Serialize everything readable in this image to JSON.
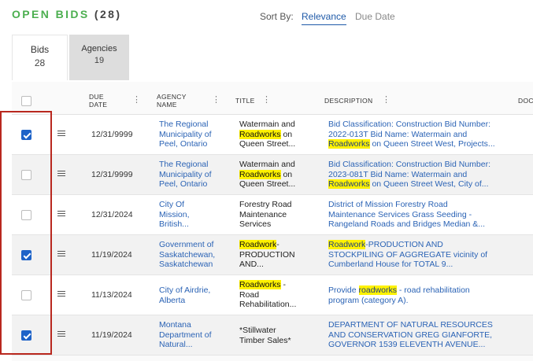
{
  "header": {
    "title_word": "OPEN BIDS",
    "title_count": "(28)",
    "sort_label": "Sort By:",
    "sort_options": [
      "Relevance",
      "Due Date"
    ],
    "sort_selected": "Relevance"
  },
  "tabs": [
    {
      "label": "Bids",
      "count": "28",
      "active": true
    },
    {
      "label": "Agencies",
      "count": "19",
      "active": false
    }
  ],
  "columns": {
    "due_date": [
      "DUE",
      "DATE"
    ],
    "agency": [
      "AGENCY",
      "NAME"
    ],
    "title": "TITLE",
    "description": "DESCRIPTION",
    "doc": "DOC"
  },
  "rows": [
    {
      "checked": true,
      "due_date": "12/31/9999",
      "agency": [
        "The Regional",
        "Municipality of",
        "Peel, Ontario"
      ],
      "title": [
        [
          "Watermain and"
        ],
        [
          {
            "hl": "Roadworks"
          },
          " on"
        ],
        [
          "Queen Street..."
        ]
      ],
      "description": [
        [
          "Bid Classification: Construction Bid Number:"
        ],
        [
          "2022-013T Bid Name: Watermain and"
        ],
        [
          {
            "hl": "Roadworks"
          },
          " on Queen Street West, Projects..."
        ]
      ]
    },
    {
      "checked": false,
      "due_date": "12/31/9999",
      "agency": [
        "The Regional",
        "Municipality of",
        "Peel, Ontario"
      ],
      "title": [
        [
          "Watermain and"
        ],
        [
          {
            "hl": "Roadworks"
          },
          " on"
        ],
        [
          "Queen Street..."
        ]
      ],
      "description": [
        [
          "Bid Classification: Construction Bid Number:"
        ],
        [
          "2023-081T Bid Name: Watermain and"
        ],
        [
          {
            "hl": "Roadworks"
          },
          " on Queen Street West, City of..."
        ]
      ]
    },
    {
      "checked": false,
      "due_date": "12/31/2024",
      "agency": [
        "City Of",
        "Mission,",
        "British..."
      ],
      "title": [
        [
          "Forestry Road"
        ],
        [
          "Maintenance"
        ],
        [
          "Services"
        ]
      ],
      "description": [
        [
          "District of Mission Forestry Road"
        ],
        [
          "Maintenance Services Grass Seeding -"
        ],
        [
          "Rangeland Roads and Bridges Median &..."
        ]
      ]
    },
    {
      "checked": true,
      "due_date": "11/19/2024",
      "agency": [
        "Government of",
        "Saskatchewan,",
        "Saskatchewan"
      ],
      "title": [
        [
          {
            "hl": "Roadwork"
          },
          "-"
        ],
        [
          "PRODUCTION"
        ],
        [
          "AND..."
        ]
      ],
      "description": [
        [
          {
            "hl": "Roadwork"
          },
          "-PRODUCTION AND"
        ],
        [
          "STOCKPILING OF AGGREGATE vicinity of"
        ],
        [
          "Cumberland House for TOTAL 9..."
        ]
      ]
    },
    {
      "checked": false,
      "due_date": "11/13/2024",
      "agency": [
        "City of Airdrie,",
        "Alberta"
      ],
      "title": [
        [
          {
            "hl": "Roadworks"
          },
          " -"
        ],
        [
          "Road"
        ],
        [
          "Rehabilitation..."
        ]
      ],
      "description": [
        [
          "Provide ",
          {
            "hl": "roadworks"
          },
          " - road rehabilitation"
        ],
        [
          "program (category A)."
        ]
      ]
    },
    {
      "checked": true,
      "due_date": "11/19/2024",
      "agency": [
        "Montana",
        "Department of",
        "Natural..."
      ],
      "title": [
        [
          "*Stillwater"
        ],
        [
          "Timber Sales*"
        ]
      ],
      "description": [
        [
          "DEPARTMENT OF NATURAL RESOURCES"
        ],
        [
          "AND CONSERVATION GREG GIANFORTE,"
        ],
        [
          "GOVERNOR 1539 ELEVENTH AVENUE..."
        ]
      ]
    }
  ]
}
